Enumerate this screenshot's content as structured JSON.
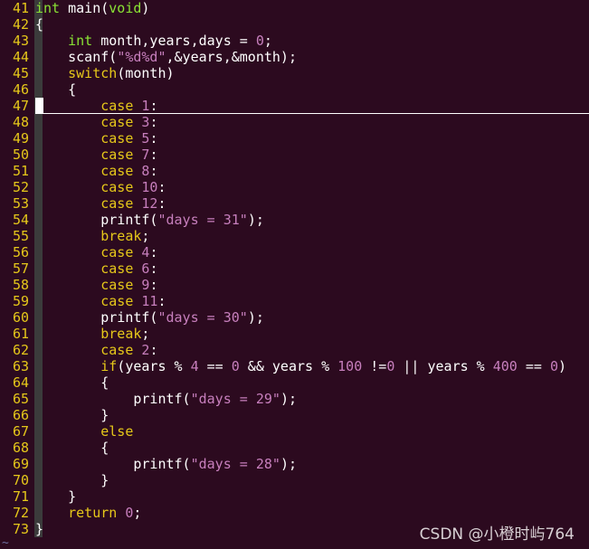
{
  "editor": {
    "watermark": "CSDN @小橙时屿764",
    "end_marker": "~",
    "lines": [
      {
        "n": "41",
        "tokens": [
          [
            "kw-type",
            "int"
          ],
          [
            "plain",
            " main("
          ],
          [
            "kw-type",
            "void"
          ],
          [
            "plain",
            ")"
          ]
        ]
      },
      {
        "n": "42",
        "tokens": [
          [
            "plain",
            "{"
          ]
        ]
      },
      {
        "n": "43",
        "tokens": [
          [
            "plain",
            "    "
          ],
          [
            "kw-type",
            "int"
          ],
          [
            "plain",
            " month,years,days = "
          ],
          [
            "num",
            "0"
          ],
          [
            "plain",
            ";"
          ]
        ]
      },
      {
        "n": "44",
        "tokens": [
          [
            "plain",
            "    scanf("
          ],
          [
            "str",
            "\"%d%d\""
          ],
          [
            "plain",
            ",&years,&month);"
          ]
        ]
      },
      {
        "n": "45",
        "tokens": [
          [
            "plain",
            "    "
          ],
          [
            "kw",
            "switch"
          ],
          [
            "plain",
            "(month)"
          ]
        ]
      },
      {
        "n": "46",
        "tokens": [
          [
            "plain",
            "    {"
          ]
        ]
      },
      {
        "n": "47",
        "tokens": [
          [
            "plain",
            "        "
          ],
          [
            "kw",
            "case"
          ],
          [
            "plain",
            " "
          ],
          [
            "num",
            "1"
          ],
          [
            "plain",
            ":"
          ]
        ]
      },
      {
        "n": "48",
        "tokens": [
          [
            "plain",
            "        "
          ],
          [
            "kw",
            "case"
          ],
          [
            "plain",
            " "
          ],
          [
            "num",
            "3"
          ],
          [
            "plain",
            ":"
          ]
        ]
      },
      {
        "n": "49",
        "tokens": [
          [
            "plain",
            "        "
          ],
          [
            "kw",
            "case"
          ],
          [
            "plain",
            " "
          ],
          [
            "num",
            "5"
          ],
          [
            "plain",
            ":"
          ]
        ]
      },
      {
        "n": "50",
        "tokens": [
          [
            "plain",
            "        "
          ],
          [
            "kw",
            "case"
          ],
          [
            "plain",
            " "
          ],
          [
            "num",
            "7"
          ],
          [
            "plain",
            ":"
          ]
        ]
      },
      {
        "n": "51",
        "tokens": [
          [
            "plain",
            "        "
          ],
          [
            "kw",
            "case"
          ],
          [
            "plain",
            " "
          ],
          [
            "num",
            "8"
          ],
          [
            "plain",
            ":"
          ]
        ]
      },
      {
        "n": "52",
        "tokens": [
          [
            "plain",
            "        "
          ],
          [
            "kw",
            "case"
          ],
          [
            "plain",
            " "
          ],
          [
            "num",
            "10"
          ],
          [
            "plain",
            ":"
          ]
        ]
      },
      {
        "n": "53",
        "tokens": [
          [
            "plain",
            "        "
          ],
          [
            "kw",
            "case"
          ],
          [
            "plain",
            " "
          ],
          [
            "num",
            "12"
          ],
          [
            "plain",
            ":"
          ]
        ]
      },
      {
        "n": "54",
        "tokens": [
          [
            "plain",
            "        printf("
          ],
          [
            "str",
            "\"days = 31\""
          ],
          [
            "plain",
            ");"
          ]
        ]
      },
      {
        "n": "55",
        "tokens": [
          [
            "plain",
            "        "
          ],
          [
            "kw",
            "break"
          ],
          [
            "plain",
            ";"
          ]
        ]
      },
      {
        "n": "56",
        "tokens": [
          [
            "plain",
            "        "
          ],
          [
            "kw",
            "case"
          ],
          [
            "plain",
            " "
          ],
          [
            "num",
            "4"
          ],
          [
            "plain",
            ":"
          ]
        ]
      },
      {
        "n": "57",
        "tokens": [
          [
            "plain",
            "        "
          ],
          [
            "kw",
            "case"
          ],
          [
            "plain",
            " "
          ],
          [
            "num",
            "6"
          ],
          [
            "plain",
            ":"
          ]
        ]
      },
      {
        "n": "58",
        "tokens": [
          [
            "plain",
            "        "
          ],
          [
            "kw",
            "case"
          ],
          [
            "plain",
            " "
          ],
          [
            "num",
            "9"
          ],
          [
            "plain",
            ":"
          ]
        ]
      },
      {
        "n": "59",
        "tokens": [
          [
            "plain",
            "        "
          ],
          [
            "kw",
            "case"
          ],
          [
            "plain",
            " "
          ],
          [
            "num",
            "11"
          ],
          [
            "plain",
            ":"
          ]
        ]
      },
      {
        "n": "60",
        "tokens": [
          [
            "plain",
            "        printf("
          ],
          [
            "str",
            "\"days = 30\""
          ],
          [
            "plain",
            ");"
          ]
        ]
      },
      {
        "n": "61",
        "tokens": [
          [
            "plain",
            "        "
          ],
          [
            "kw",
            "break"
          ],
          [
            "plain",
            ";"
          ]
        ]
      },
      {
        "n": "62",
        "tokens": [
          [
            "plain",
            "        "
          ],
          [
            "kw",
            "case"
          ],
          [
            "plain",
            " "
          ],
          [
            "num",
            "2"
          ],
          [
            "plain",
            ":"
          ]
        ]
      },
      {
        "n": "63",
        "tokens": [
          [
            "plain",
            "        "
          ],
          [
            "kw",
            "if"
          ],
          [
            "plain",
            "(years % "
          ],
          [
            "num",
            "4"
          ],
          [
            "plain",
            " == "
          ],
          [
            "num",
            "0"
          ],
          [
            "plain",
            " && years % "
          ],
          [
            "num",
            "100"
          ],
          [
            "plain",
            " !="
          ],
          [
            "num",
            "0"
          ],
          [
            "plain",
            " || years % "
          ],
          [
            "num",
            "400"
          ],
          [
            "plain",
            " == "
          ],
          [
            "num",
            "0"
          ],
          [
            "plain",
            ")"
          ]
        ]
      },
      {
        "n": "64",
        "tokens": [
          [
            "plain",
            "        {"
          ]
        ]
      },
      {
        "n": "65",
        "tokens": [
          [
            "plain",
            "            printf("
          ],
          [
            "str",
            "\"days = 29\""
          ],
          [
            "plain",
            ");"
          ]
        ]
      },
      {
        "n": "66",
        "tokens": [
          [
            "plain",
            "        }"
          ]
        ]
      },
      {
        "n": "67",
        "tokens": [
          [
            "plain",
            "        "
          ],
          [
            "kw",
            "else"
          ]
        ]
      },
      {
        "n": "68",
        "tokens": [
          [
            "plain",
            "        {"
          ]
        ]
      },
      {
        "n": "69",
        "tokens": [
          [
            "plain",
            "            printf("
          ],
          [
            "str",
            "\"days = 28\""
          ],
          [
            "plain",
            ");"
          ]
        ]
      },
      {
        "n": "70",
        "tokens": [
          [
            "plain",
            "        }"
          ]
        ]
      },
      {
        "n": "71",
        "tokens": [
          [
            "plain",
            "    }"
          ]
        ]
      },
      {
        "n": "72",
        "tokens": [
          [
            "plain",
            "    "
          ],
          [
            "kw",
            "return"
          ],
          [
            "plain",
            " "
          ],
          [
            "num",
            "0"
          ],
          [
            "plain",
            ";"
          ]
        ]
      },
      {
        "n": "73",
        "tokens": [
          [
            "plain",
            "}"
          ]
        ]
      }
    ],
    "cursor_line": "47"
  }
}
